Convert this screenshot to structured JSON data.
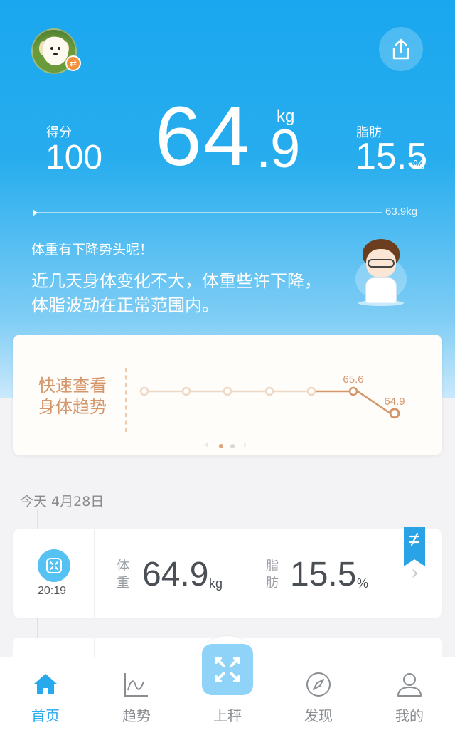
{
  "header": {
    "avatar_icon": "dog-avatar",
    "switch_icon": "swap-icon",
    "share_icon": "share-icon"
  },
  "stats": {
    "score_label": "得分",
    "score_value": "100",
    "weight_int": "64",
    "weight_dot": ".",
    "weight_dec": "9",
    "weight_unit": "kg",
    "fat_label": "脂肪",
    "fat_value": "15.5",
    "fat_unit": "%"
  },
  "progress": {
    "target_label": "63.9kg",
    "fraction": 0.0
  },
  "advice": {
    "trend_message": "体重有下降势头呢！",
    "summary": "近几天身体变化不大，体重些许下降，体脂波动在正常范围内。"
  },
  "trend_card": {
    "title_line1": "快速查看",
    "title_line2": "身体趋势",
    "points": [
      null,
      null,
      null,
      null,
      null,
      65.6,
      64.9
    ],
    "labels": [
      "",
      "",
      "",
      "",
      "",
      "65.6",
      "64.9"
    ],
    "color": "#d4966b",
    "page_count": 2,
    "active_page": 0
  },
  "timeline": {
    "date_label": "今天 4月28日"
  },
  "record": {
    "time": "20:19",
    "weight_label": "体重",
    "weight_value": "64.9",
    "weight_unit": "kg",
    "fat_label": "脂肪",
    "fat_value": "15.5",
    "fat_unit": "%",
    "bookmark_icon": "flag-icon"
  },
  "tabbar": {
    "tabs": [
      {
        "label": "首页",
        "icon": "home-icon",
        "active": true
      },
      {
        "label": "趋势",
        "icon": "trend-icon",
        "active": false
      },
      {
        "label": "上秤",
        "icon": "scale-icon",
        "active": false
      },
      {
        "label": "发现",
        "icon": "compass-icon",
        "active": false
      },
      {
        "label": "我的",
        "icon": "user-icon",
        "active": false
      }
    ],
    "accent": "#27a9ee"
  }
}
